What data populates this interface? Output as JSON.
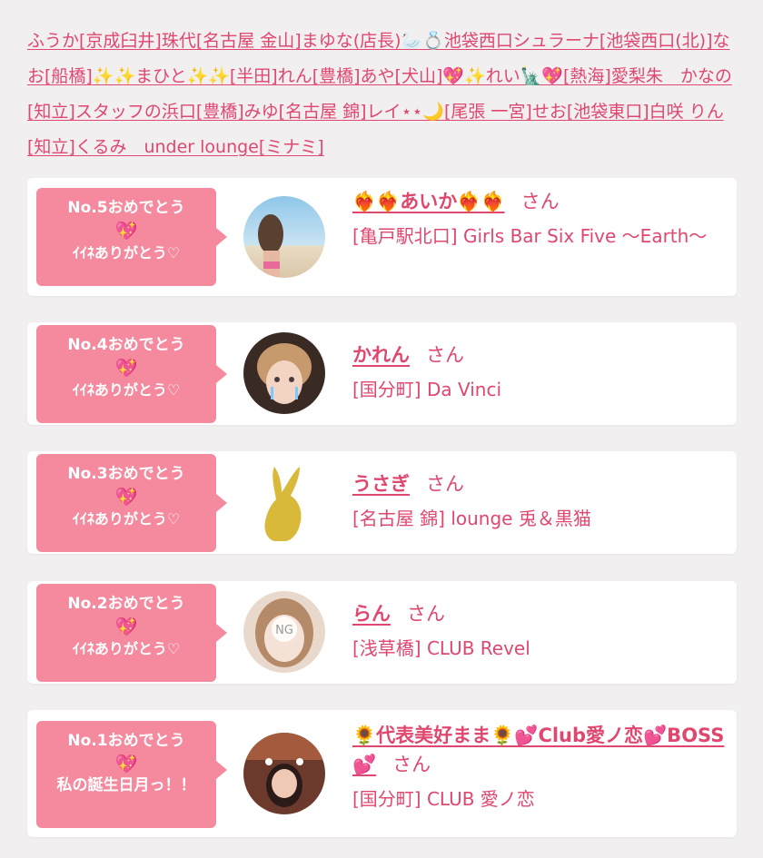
{
  "header_links": [
    "ふうか[京成臼井]",
    "珠代[名古屋 金山]",
    "まゆな(店長)🦢💍池袋西口シュラーナ[池袋西口(北)]",
    "なお[船橋]",
    "✨✨まひと✨✨[半田]",
    "れん[豊橋]",
    "あや[犬山]",
    "💖✨れい🗽💖[熱海]",
    "愛梨朱　かなの[知立]",
    "スタッフの浜口[豊橋]",
    "みゆ[名古屋 錦]",
    "レイ⋆⋆🌙[尾張 一宮]",
    "せお[池袋東口]",
    "白咲 りん[知立]",
    "くるみ　under lounge[ミナミ]"
  ],
  "ranking": [
    {
      "rank_label": "No.5おめでとう",
      "heart": "💖",
      "message": "ｲｲﾈありがとう♡",
      "name": "❤️‍🔥❤️‍🔥あいか❤️‍🔥❤️‍🔥",
      "suffix": "さん",
      "shop": "[亀戸駅北口] Girls Bar Six Five 〜Earth〜",
      "avatar": "photo-beach"
    },
    {
      "rank_label": "No.4おめでとう",
      "heart": "💖",
      "message": "ｲｲﾈありがとう♡",
      "name": "かれん",
      "suffix": "さん",
      "shop": "[国分町] Da Vinci",
      "avatar": "photo-selfie"
    },
    {
      "rank_label": "No.3おめでとう",
      "heart": "💖",
      "message": "ｲｲﾈありがとう♡",
      "name": "うさぎ",
      "suffix": "さん",
      "shop": "[名古屋 錦] lounge 兎＆黒猫",
      "avatar": "rabbit-silhouette"
    },
    {
      "rank_label": "No.2おめでとう",
      "heart": "💖",
      "message": "ｲｲﾈありがとう♡",
      "name": "らん",
      "suffix": "さん",
      "shop": "[浅草橋] CLUB Revel",
      "avatar": "photo-ng"
    },
    {
      "rank_label": "No.1おめでとう",
      "heart": "💖",
      "message": "私の誕生日月っ！！",
      "name": "🌻代表美好まま🌻💕Club愛ノ恋💕BOSS💕",
      "suffix": "さん",
      "shop": "[国分町] CLUB 愛ノ恋",
      "avatar": "photo-club"
    }
  ],
  "colors": {
    "accent": "#e0476f",
    "bubble": "#f58a9e",
    "background": "#f1eff0",
    "rabbit": "#d9b93a"
  }
}
